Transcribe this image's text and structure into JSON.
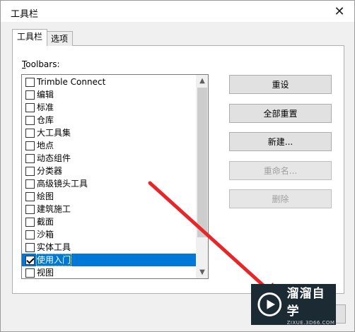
{
  "window": {
    "title": "工具栏"
  },
  "tabs": [
    {
      "label": "工具栏",
      "active": true
    },
    {
      "label": "选项",
      "active": false
    }
  ],
  "toolbars_label": {
    "accel": "T",
    "rest": "oolbars:"
  },
  "list": {
    "items": [
      {
        "label": "Trimble Connect",
        "checked": false,
        "selected": false
      },
      {
        "label": "编辑",
        "checked": false,
        "selected": false
      },
      {
        "label": "标准",
        "checked": false,
        "selected": false
      },
      {
        "label": "仓库",
        "checked": false,
        "selected": false
      },
      {
        "label": "大工具集",
        "checked": false,
        "selected": false
      },
      {
        "label": "地点",
        "checked": false,
        "selected": false
      },
      {
        "label": "动态组件",
        "checked": false,
        "selected": false
      },
      {
        "label": "分类器",
        "checked": false,
        "selected": false
      },
      {
        "label": "高级镜头工具",
        "checked": false,
        "selected": false
      },
      {
        "label": "绘图",
        "checked": false,
        "selected": false
      },
      {
        "label": "建筑施工",
        "checked": false,
        "selected": false
      },
      {
        "label": "截面",
        "checked": false,
        "selected": false
      },
      {
        "label": "沙箱",
        "checked": false,
        "selected": false
      },
      {
        "label": "实体工具",
        "checked": false,
        "selected": false
      },
      {
        "label": "使用入门",
        "checked": true,
        "selected": true
      },
      {
        "label": "视图",
        "checked": false,
        "selected": false
      }
    ]
  },
  "buttons": {
    "reset": "重设",
    "reset_all": "全部重置",
    "new": "新建...",
    "rename": "重命名...",
    "delete": "删除"
  },
  "watermark": {
    "title": "溜溜自学",
    "subtitle": "ZIXUE.3D66.COM"
  },
  "colors": {
    "selection": "#0078d7",
    "arrow": "#e8262a"
  },
  "icons": {
    "close": "✕",
    "scroll_up": "▲",
    "scroll_down": "▼"
  }
}
